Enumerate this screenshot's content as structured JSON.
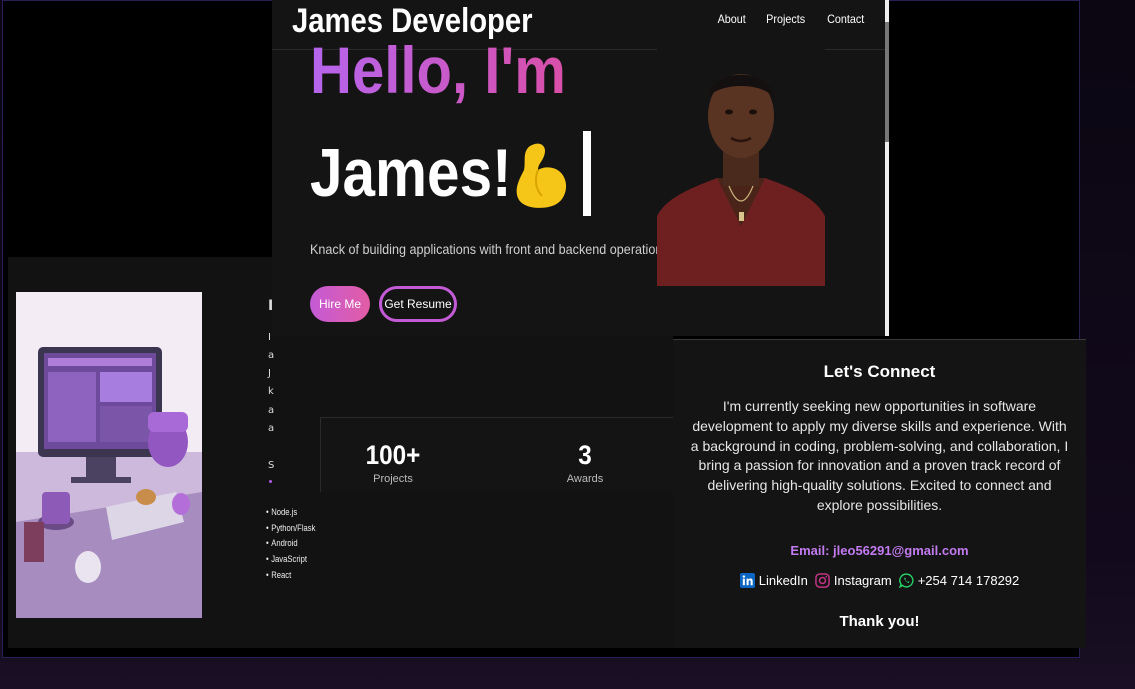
{
  "brand": "James Developer",
  "nav": [
    "About",
    "Projects",
    "Contact"
  ],
  "hero": {
    "greeting": "Hello, I'm",
    "name": "James!",
    "tagline": "Knack of building applications with front and backend operation",
    "hire_label": "Hire Me",
    "resume_label": "Get Resume"
  },
  "stats": [
    {
      "value": "100+",
      "label": "Projects"
    },
    {
      "value": "3",
      "label": "Awards"
    }
  ],
  "about_stub": [
    "I",
    "a",
    "J",
    "k",
    "a",
    "a",
    "S"
  ],
  "skills": [
    "Node.js",
    "Python/Flask",
    "Android",
    "JavaScript",
    "React"
  ],
  "contact": {
    "title": "Let's Connect",
    "body": "I'm currently seeking new opportunities in software development to apply my diverse skills and experience. With a background in coding, problem-solving, and collaboration, I bring a passion for innovation and a proven track record of delivering high-quality solutions. Excited to connect and explore possibilities.",
    "email": "Email: jleo56291@gmail.com",
    "linkedin": "LinkedIn",
    "instagram": "Instagram",
    "phone": "+254 714 178292",
    "closing": "Thank you!"
  },
  "icons": {
    "flex": "flexed-biceps-icon",
    "linkedin": "linkedin-icon",
    "instagram": "instagram-icon",
    "whatsapp": "whatsapp-icon"
  },
  "colors": {
    "accent_purple": "#b565ee",
    "accent_pink": "#d94fa8",
    "email": "#c37bf0",
    "linkedin": "#0a66c2",
    "instagram": "#c13584",
    "whatsapp": "#25d366",
    "flex_icon": "#f5c518"
  }
}
